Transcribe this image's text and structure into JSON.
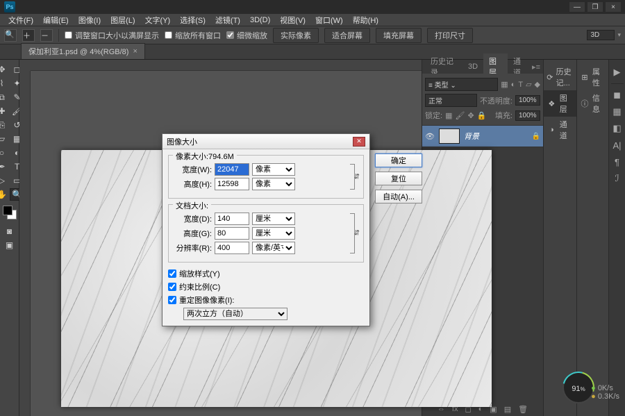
{
  "app": {
    "logo": "Ps"
  },
  "win": {
    "min": "—",
    "max": "❐",
    "close": "×"
  },
  "menu": [
    "文件(F)",
    "编辑(E)",
    "图像(I)",
    "图层(L)",
    "文字(Y)",
    "选择(S)",
    "滤镜(T)",
    "3D(D)",
    "视图(V)",
    "窗口(W)",
    "帮助(H)"
  ],
  "options": {
    "fit_window": "调整窗口大小以满屏显示",
    "all_windows": "缩放所有窗口",
    "scrubby": "细微缩放",
    "actual": "实际像素",
    "fit": "适合屏幕",
    "fill": "填充屏幕",
    "print": "打印尺寸",
    "right_field": "3D"
  },
  "doc_tab": {
    "name": "保加利亚1.psd @ 4%(RGB/8)",
    "close": "×"
  },
  "panel_tabs": [
    "历史记录",
    "3D",
    "图层",
    "通道"
  ],
  "layers_panel": {
    "kind_label": "≡ 类型 ⌄",
    "blend": "正常",
    "opacity_label": "不透明度:",
    "opacity_value": "100%",
    "lock_label": "锁定:",
    "fill_label": "填充:",
    "fill_value": "100%",
    "layer_name": "背景"
  },
  "right_strip": {
    "history": "历史记...",
    "layers": "图层",
    "channels": "通道"
  },
  "props_strip": {
    "props": "属性",
    "info": "信息"
  },
  "dialog": {
    "title": "图像大小",
    "pixel_legend": "像素大小:794.6M",
    "width_label": "宽度(W):",
    "width_value": "22047",
    "height_label": "高度(H):",
    "height_value": "12598",
    "px_unit": "像素",
    "doc_legend": "文档大小:",
    "doc_width_label": "宽度(D):",
    "doc_width_value": "140",
    "doc_height_label": "高度(G):",
    "doc_height_value": "80",
    "cm_unit": "厘米",
    "res_label": "分辨率(R):",
    "res_value": "400",
    "res_unit": "像素/英寸",
    "chk_styles": "缩放样式(Y)",
    "chk_constrain": "约束比例(C)",
    "chk_resample": "重定图像像素(I):",
    "resample_method": "两次立方（自动）",
    "ok": "确定",
    "reset": "复位",
    "auto": "自动(A)..."
  },
  "perf": {
    "value": "91",
    "unit": "%",
    "rate1": "0K/s",
    "rate2": "0.3K/s"
  }
}
